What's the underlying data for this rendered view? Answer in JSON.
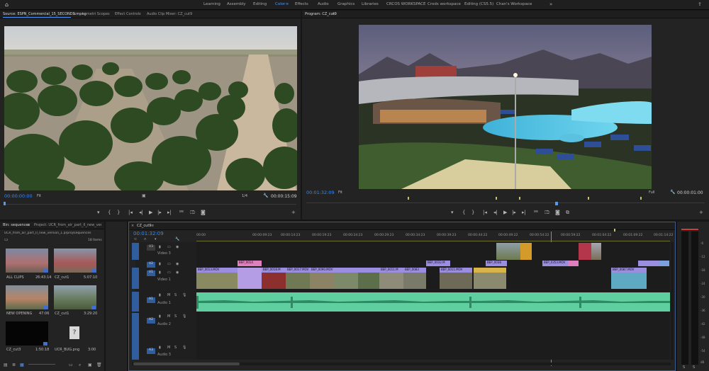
{
  "topbar": {
    "workspaces": [
      "Learning",
      "Assembly",
      "Editing",
      "Color",
      "Effects",
      "Audio",
      "Graphics",
      "Libraries",
      "CRCOS WORKSPACE",
      "Crods workspace",
      "Editing (CS5.5)",
      "Chan's Workspace"
    ],
    "active": "Color"
  },
  "source": {
    "tabs": [
      "Source: ESPN_Commercial_15_SECONDS.mpeg",
      "Lumetri Scopes",
      "Effect Controls",
      "Audio Clip Mixer: CZ_cut9"
    ],
    "timecode": "00:00:00:00",
    "zoom": "Fit",
    "fraction": "1/4",
    "duration": "00:00:15:09"
  },
  "program": {
    "tab": "Program: CZ_cut9",
    "timecode": "00:01:32:09",
    "zoom": "Fit",
    "quality": "Full",
    "duration": "00:00:01:00"
  },
  "project": {
    "tabs": [
      "Bin: sequences",
      "Project: UCR_from_air_part_II_new_version"
    ],
    "path": "UCR_from_air_part_II_new_version_1.prproj\\sequences",
    "count": "18 Items",
    "items": [
      {
        "name": "ALL CLIPS",
        "dur": "26:43:14"
      },
      {
        "name": "CZ_cut1",
        "dur": "5:07:10"
      },
      {
        "name": "NEW OPENING",
        "dur": "47:06"
      },
      {
        "name": "CZ_cut1",
        "dur": "3:29:20"
      },
      {
        "name": "CZ_cut3",
        "dur": "1:50:18"
      },
      {
        "name": "UCR_BUG.png",
        "dur": "3:00"
      }
    ]
  },
  "timeline": {
    "tab": "CZ_cut9",
    "timecode": "00:01:32:09",
    "ruler": [
      "00:00",
      "00:00:09:23",
      "00:00:14:23",
      "00:00:19:23",
      "00:00:24:23",
      "00:00:29:23",
      "00:00:34:23",
      "00:00:39:23",
      "00:00:44:22",
      "00:00:49:22",
      "00:00:54:22",
      "00:00:59:22",
      "00:01:04:22",
      "00:01:09:22",
      "00:01:14:22"
    ],
    "tracks": {
      "v3": "V3",
      "v2": "V2",
      "v1": "V1",
      "a1": "A1",
      "a2": "A2",
      "a3": "A3",
      "video3": "Video 3",
      "video1": "Video 1",
      "audio1": "Audio 1",
      "audio2": "Audio 2",
      "audio3": "Audio 3"
    },
    "clips_v2": [
      "BEP_0014",
      "BEP_0032.M",
      "BEP_0038",
      "BEP_0353.MOV"
    ],
    "clips_v1": [
      "BEP_0013.MOV",
      "BEP_0018.M",
      "BEP_0017.MOV",
      "BEP_0090.MOV",
      "BEP_0011.M",
      "BEP_0083",
      "BEP_0011.MOV",
      "BEP_0087.MOV"
    ]
  },
  "meter": {
    "scale": [
      "-6",
      "-12",
      "-18",
      "-24",
      "-30",
      "-36",
      "-42",
      "-48",
      "-54",
      "dB"
    ]
  }
}
